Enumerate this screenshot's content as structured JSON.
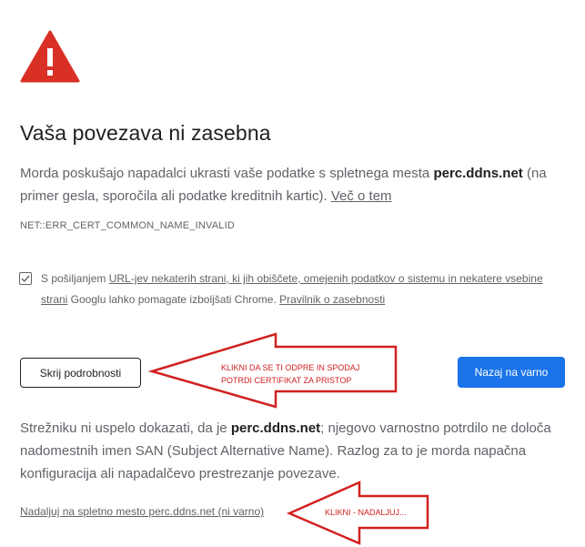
{
  "interstitial": {
    "title": "Vaša povezava ni zasebna",
    "intro_before": "Morda poskušajo napadalci ukrasti vaše podatke s spletnega mesta ",
    "domain": "perc.ddns.net",
    "intro_after": " (na primer gesla, sporočila ali podatke kreditnih kartic). ",
    "learn_more": "Več o tem",
    "error_code": "NET::ERR_CERT_COMMON_NAME_INVALID"
  },
  "consent": {
    "checked": true,
    "text_before": "S pošiljanjem ",
    "link_urls": "URL-jev nekaterih strani, ki jih obiščete, omejenih podatkov o sistemu in nekatere vsebine strani",
    "text_middle": " Googlu lahko pomagate izboljšati Chrome. ",
    "link_privacy": "Pravilnik o zasebnosti"
  },
  "buttons": {
    "hide_details": "Skrij podrobnosti",
    "back_to_safety": "Nazaj na varno"
  },
  "details": {
    "text_before": "Strežniku ni uspelo dokazati, da je ",
    "domain": "perc.ddns.net",
    "text_after": "; njegovo varnostno potrdilo ne določa nadomestnih imen SAN (Subject Alternative Name). Razlog za to je morda napačna konfiguracija ali napadalčevo prestrezanje povezave.",
    "proceed_link": "Nadaljuj na spletno mesto perc.ddns.net (ni varno)"
  },
  "annotations": {
    "arrow1_line1": "KLIKNI DA SE TI ODPRE IN SPODAJ",
    "arrow1_line2": "POTRDI CERTIFIKAT ZA PRISTOP",
    "arrow2_text": "KLIKNI - NADALJUJ...",
    "color": "#d22020"
  },
  "colors": {
    "primary_button": "#1a73e8",
    "warning_red": "#d93025",
    "secondary_text": "#5f6368",
    "primary_text": "#202124"
  },
  "icons": {
    "warning": "warning-triangle-icon",
    "checkbox": "checkmark-icon"
  }
}
